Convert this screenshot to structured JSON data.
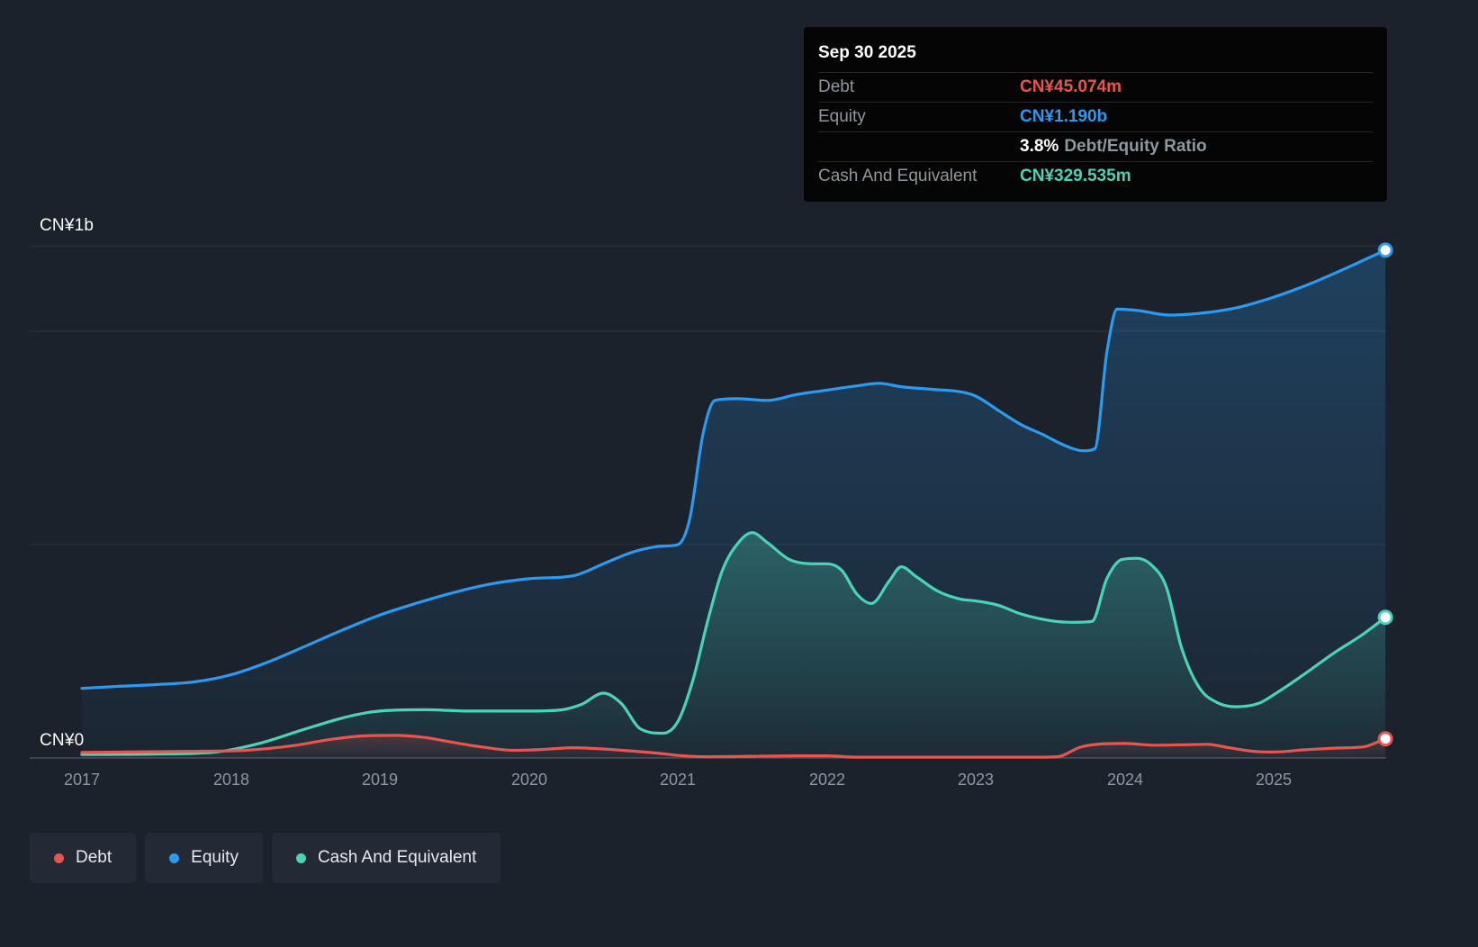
{
  "colors": {
    "debt": "#e8544e",
    "equity": "#2b9af0",
    "cash": "#4ad3b4",
    "background": "#1b222c"
  },
  "y_axis": {
    "top_label": "CN¥1b",
    "bottom_label": "CN¥0"
  },
  "x_axis": {
    "ticks": [
      "2017",
      "2018",
      "2019",
      "2020",
      "2021",
      "2022",
      "2023",
      "2024",
      "2025"
    ]
  },
  "tooltip": {
    "date": "Sep 30 2025",
    "debt": {
      "label": "Debt",
      "value": "CN¥45.074m",
      "color": "#e8544e"
    },
    "equity": {
      "label": "Equity",
      "value": "CN¥1.190b",
      "color": "#2b9af0"
    },
    "ratio": {
      "value": "3.8%",
      "label": "Debt/Equity Ratio"
    },
    "cash": {
      "label": "Cash And Equivalent",
      "value": "CN¥329.535m",
      "color": "#4ad3b4"
    }
  },
  "legend": {
    "items": [
      {
        "label": "Debt",
        "color": "#e8544e"
      },
      {
        "label": "Equity",
        "color": "#2b9af0"
      },
      {
        "label": "Cash And Equivalent",
        "color": "#4ad3b4"
      }
    ]
  },
  "chart_data": {
    "type": "area",
    "unit": "CN¥ billions",
    "x_range": [
      2017,
      2025.75
    ],
    "ylim": [
      0,
      1.25
    ],
    "grid": true,
    "y_gridlines_b": [
      0.5,
      1.0,
      1.2
    ],
    "legend_position": "bottom-left",
    "series": [
      {
        "key": "equity",
        "name": "Equity",
        "color": "#2b9af0",
        "fill_opacity": 0.26,
        "points": [
          [
            2017.0,
            0.163
          ],
          [
            2017.25,
            0.168
          ],
          [
            2017.5,
            0.172
          ],
          [
            2017.75,
            0.178
          ],
          [
            2018.0,
            0.195
          ],
          [
            2018.25,
            0.225
          ],
          [
            2018.5,
            0.262
          ],
          [
            2018.75,
            0.3
          ],
          [
            2019.0,
            0.335
          ],
          [
            2019.25,
            0.363
          ],
          [
            2019.5,
            0.388
          ],
          [
            2019.75,
            0.408
          ],
          [
            2020.0,
            0.42
          ],
          [
            2020.3,
            0.427
          ],
          [
            2020.5,
            0.455
          ],
          [
            2020.7,
            0.483
          ],
          [
            2020.85,
            0.495
          ],
          [
            2021.0,
            0.5
          ],
          [
            2021.08,
            0.56
          ],
          [
            2021.17,
            0.76
          ],
          [
            2021.25,
            0.838
          ],
          [
            2021.4,
            0.842
          ],
          [
            2021.6,
            0.838
          ],
          [
            2021.8,
            0.852
          ],
          [
            2022.0,
            0.862
          ],
          [
            2022.2,
            0.872
          ],
          [
            2022.35,
            0.878
          ],
          [
            2022.5,
            0.87
          ],
          [
            2022.7,
            0.864
          ],
          [
            2022.9,
            0.858
          ],
          [
            2023.0,
            0.848
          ],
          [
            2023.15,
            0.815
          ],
          [
            2023.3,
            0.782
          ],
          [
            2023.45,
            0.758
          ],
          [
            2023.6,
            0.732
          ],
          [
            2023.72,
            0.72
          ],
          [
            2023.8,
            0.725
          ],
          [
            2023.88,
            0.95
          ],
          [
            2023.95,
            1.052
          ],
          [
            2024.1,
            1.048
          ],
          [
            2024.3,
            1.038
          ],
          [
            2024.5,
            1.042
          ],
          [
            2024.75,
            1.055
          ],
          [
            2025.0,
            1.08
          ],
          [
            2025.25,
            1.112
          ],
          [
            2025.5,
            1.15
          ],
          [
            2025.75,
            1.19
          ]
        ]
      },
      {
        "key": "cash",
        "name": "Cash And Equivalent",
        "color": "#4ad3b4",
        "fill_opacity": 0.3,
        "points": [
          [
            2017.0,
            0.008
          ],
          [
            2017.5,
            0.009
          ],
          [
            2017.9,
            0.014
          ],
          [
            2018.2,
            0.035
          ],
          [
            2018.5,
            0.068
          ],
          [
            2018.8,
            0.098
          ],
          [
            2019.0,
            0.11
          ],
          [
            2019.3,
            0.113
          ],
          [
            2019.6,
            0.11
          ],
          [
            2020.0,
            0.11
          ],
          [
            2020.2,
            0.112
          ],
          [
            2020.35,
            0.125
          ],
          [
            2020.5,
            0.152
          ],
          [
            2020.62,
            0.128
          ],
          [
            2020.75,
            0.068
          ],
          [
            2020.9,
            0.058
          ],
          [
            2021.0,
            0.085
          ],
          [
            2021.1,
            0.18
          ],
          [
            2021.2,
            0.32
          ],
          [
            2021.3,
            0.44
          ],
          [
            2021.42,
            0.51
          ],
          [
            2021.5,
            0.528
          ],
          [
            2021.6,
            0.505
          ],
          [
            2021.75,
            0.465
          ],
          [
            2021.9,
            0.455
          ],
          [
            2022.0,
            0.455
          ],
          [
            2022.1,
            0.44
          ],
          [
            2022.2,
            0.385
          ],
          [
            2022.3,
            0.362
          ],
          [
            2022.42,
            0.415
          ],
          [
            2022.5,
            0.448
          ],
          [
            2022.6,
            0.425
          ],
          [
            2022.75,
            0.39
          ],
          [
            2022.9,
            0.372
          ],
          [
            2023.0,
            0.368
          ],
          [
            2023.15,
            0.358
          ],
          [
            2023.3,
            0.338
          ],
          [
            2023.5,
            0.322
          ],
          [
            2023.65,
            0.318
          ],
          [
            2023.78,
            0.32
          ],
          [
            2023.88,
            0.42
          ],
          [
            2023.98,
            0.465
          ],
          [
            2024.08,
            0.468
          ],
          [
            2024.18,
            0.452
          ],
          [
            2024.28,
            0.4
          ],
          [
            2024.38,
            0.26
          ],
          [
            2024.5,
            0.165
          ],
          [
            2024.62,
            0.13
          ],
          [
            2024.75,
            0.12
          ],
          [
            2024.9,
            0.128
          ],
          [
            2025.0,
            0.148
          ],
          [
            2025.2,
            0.195
          ],
          [
            2025.4,
            0.245
          ],
          [
            2025.6,
            0.29
          ],
          [
            2025.75,
            0.3295
          ]
        ]
      },
      {
        "key": "debt",
        "name": "Debt",
        "color": "#e8544e",
        "fill_opacity": 0.22,
        "points": [
          [
            2017.0,
            0.013
          ],
          [
            2017.3,
            0.014
          ],
          [
            2017.6,
            0.015
          ],
          [
            2017.9,
            0.016
          ],
          [
            2018.1,
            0.018
          ],
          [
            2018.4,
            0.028
          ],
          [
            2018.7,
            0.045
          ],
          [
            2018.9,
            0.052
          ],
          [
            2019.1,
            0.053
          ],
          [
            2019.3,
            0.048
          ],
          [
            2019.5,
            0.036
          ],
          [
            2019.7,
            0.025
          ],
          [
            2019.9,
            0.018
          ],
          [
            2020.1,
            0.02
          ],
          [
            2020.3,
            0.024
          ],
          [
            2020.5,
            0.021
          ],
          [
            2020.7,
            0.016
          ],
          [
            2020.9,
            0.01
          ],
          [
            2021.0,
            0.006
          ],
          [
            2021.2,
            0.003
          ],
          [
            2021.5,
            0.004
          ],
          [
            2021.8,
            0.005
          ],
          [
            2022.0,
            0.005
          ],
          [
            2022.2,
            0.002
          ],
          [
            2022.5,
            0.002
          ],
          [
            2022.8,
            0.002
          ],
          [
            2023.1,
            0.002
          ],
          [
            2023.4,
            0.002
          ],
          [
            2023.55,
            0.003
          ],
          [
            2023.7,
            0.025
          ],
          [
            2023.85,
            0.033
          ],
          [
            2024.0,
            0.034
          ],
          [
            2024.2,
            0.03
          ],
          [
            2024.4,
            0.031
          ],
          [
            2024.55,
            0.032
          ],
          [
            2024.7,
            0.024
          ],
          [
            2024.85,
            0.016
          ],
          [
            2025.0,
            0.014
          ],
          [
            2025.2,
            0.019
          ],
          [
            2025.4,
            0.023
          ],
          [
            2025.6,
            0.026
          ],
          [
            2025.75,
            0.045
          ]
        ]
      }
    ]
  }
}
